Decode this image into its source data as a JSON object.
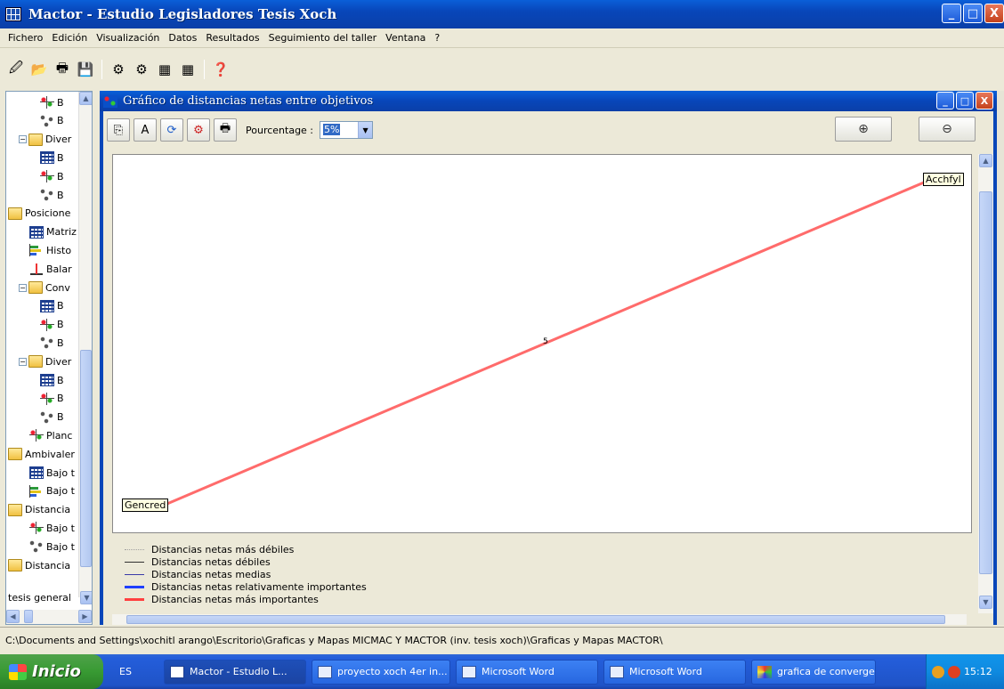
{
  "window": {
    "title": "Mactor  -  Estudio Legisladores Tesis Xoch",
    "minimize": "_",
    "maximize": "□",
    "close": "X"
  },
  "menu": [
    "Fichero",
    "Edición",
    "Visualización",
    "Datos",
    "Resultados",
    "Seguimiento del taller",
    "Ventana",
    "?"
  ],
  "toolbar_icons": [
    "open-icon",
    "folder-icon",
    "print-icon",
    "save-icon",
    "actors-icon",
    "objectives-icon",
    "matrix-icon",
    "matrix2-icon",
    "help-icon"
  ],
  "tree": {
    "items": [
      {
        "label": "B",
        "icon": "plane-icon",
        "expander": ""
      },
      {
        "label": "B",
        "icon": "graph-icon",
        "expander": ""
      },
      {
        "label": "Diver",
        "icon": "folder-icon",
        "expander": "−"
      },
      {
        "label": "B",
        "icon": "matrix-icon",
        "expander": ""
      },
      {
        "label": "B",
        "icon": "plane-icon",
        "expander": ""
      },
      {
        "label": "B",
        "icon": "graph-icon",
        "expander": ""
      },
      {
        "label": "Posicione",
        "icon": "folder-icon",
        "expander": ""
      },
      {
        "label": "Matriz",
        "icon": "matrix-icon",
        "expander": ""
      },
      {
        "label": "Histo",
        "icon": "histogram-icon",
        "expander": ""
      },
      {
        "label": "Balar",
        "icon": "balance-icon",
        "expander": ""
      },
      {
        "label": "Conv",
        "icon": "folder-icon",
        "expander": "−"
      },
      {
        "label": "B",
        "icon": "matrix-icon",
        "expander": ""
      },
      {
        "label": "B",
        "icon": "plane-icon",
        "expander": ""
      },
      {
        "label": "B",
        "icon": "graph-icon",
        "expander": ""
      },
      {
        "label": "Diver",
        "icon": "folder-icon",
        "expander": "−"
      },
      {
        "label": "B",
        "icon": "matrix-icon",
        "expander": ""
      },
      {
        "label": "B",
        "icon": "plane-icon",
        "expander": ""
      },
      {
        "label": "B",
        "icon": "graph-icon",
        "expander": ""
      },
      {
        "label": "Planc",
        "icon": "plane-icon",
        "expander": ""
      },
      {
        "label": "Ambivaler",
        "icon": "folder-icon",
        "expander": ""
      },
      {
        "label": "Bajo t",
        "icon": "matrix-icon",
        "expander": ""
      },
      {
        "label": "Bajo t",
        "icon": "histogram-icon",
        "expander": ""
      },
      {
        "label": "Distancia",
        "icon": "folder-icon",
        "expander": ""
      },
      {
        "label": "Bajo t",
        "icon": "plane-icon",
        "expander": ""
      },
      {
        "label": "Bajo t",
        "icon": "graph-icon",
        "expander": ""
      },
      {
        "label": "Distancia",
        "icon": "folder-icon",
        "expander": ""
      }
    ],
    "footer": "tesis general"
  },
  "child": {
    "title": "Gráfico de distancias netas entre objetivos",
    "percent_label": "Pourcentage :",
    "percent_value": "5%",
    "zoom_in": "⊕",
    "zoom_out": "⊖"
  },
  "chart_data": {
    "type": "network",
    "nodes": [
      {
        "label": "Gencred",
        "x": 0,
        "y": 0
      },
      {
        "label": "Acchfyl",
        "x": 1,
        "y": 1
      }
    ],
    "edges": [
      {
        "from": "Gencred",
        "to": "Acchfyl",
        "value": 5,
        "label": "5",
        "class": "Distancias netas más importantes",
        "color": "#ff6b6b"
      }
    ],
    "legend": [
      {
        "label": "Distancias netas más débiles",
        "color": "#a0a0a0",
        "style": "dotted"
      },
      {
        "label": "Distancias netas débiles",
        "color": "#303030",
        "style": "solid"
      },
      {
        "label": "Distancias netas medias",
        "color": "#3a3aa8",
        "style": "solid"
      },
      {
        "label": "Distancias netas relativamente importantes",
        "color": "#1f3fff",
        "style": "thick"
      },
      {
        "label": "Distancias netas más importantes",
        "color": "#ff4040",
        "style": "thick"
      }
    ]
  },
  "status": {
    "path": "C:\\Documents and Settings\\xochitl arango\\Escritorio\\Graficas y Mapas MICMAC Y MACTOR (inv. tesis xoch)\\Graficas y Mapas MACTOR\\"
  },
  "taskbar": {
    "start": "Inicio",
    "lang": "ES",
    "tasks": [
      {
        "label": "Mactor  -  Estudio L...",
        "icon": "mactor"
      },
      {
        "label": "proyecto xoch 4er in...",
        "icon": "word"
      },
      {
        "label": "Microsoft Word",
        "icon": "word"
      },
      {
        "label": "Microsoft Word",
        "icon": "word"
      },
      {
        "label": "grafica de converge...",
        "icon": "paint"
      }
    ],
    "clock": "15:12"
  }
}
